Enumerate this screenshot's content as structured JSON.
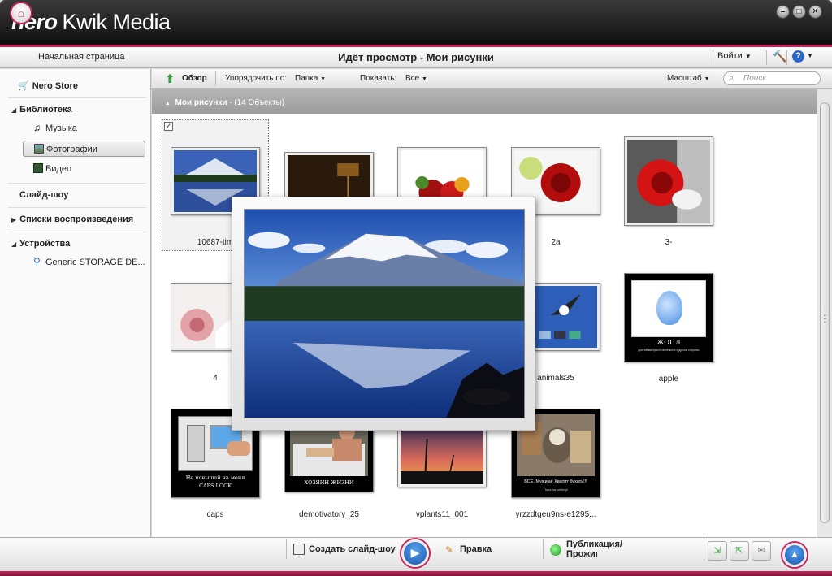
{
  "window": {
    "brand": "nero",
    "product": "Kwik Media",
    "controls": [
      "minimize",
      "maximize",
      "close"
    ]
  },
  "nav": {
    "home_label": "Начальная страница",
    "title": "Идёт просмотр - Мои рисунки",
    "login": "Войти"
  },
  "sidebar": {
    "store": "Nero Store",
    "library": "Библиотека",
    "music": "Музыка",
    "photos": "Фотографии",
    "video": "Видео",
    "slideshow": "Слайд-шоу",
    "playlists": "Списки воспроизведения",
    "devices": "Устройства",
    "device_item": "Generic STORAGE DE..."
  },
  "toolbar": {
    "browse": "Обзор",
    "sort_label": "Упорядочить по:",
    "sort_value": "Папка",
    "show_label": "Показать:",
    "show_value": "Все",
    "zoom": "Масштаб",
    "search_placeholder": "Поиск"
  },
  "group": {
    "name": "Мои рисунки",
    "count": "- (14 Объекты)"
  },
  "tiles": [
    {
      "caption": "10687-tim",
      "img": "mountain"
    },
    {
      "caption": "",
      "img": "lamp"
    },
    {
      "caption": "",
      "img": "roses"
    },
    {
      "caption": "2a",
      "img": "redrose"
    },
    {
      "caption": "3-",
      "img": "bwrose"
    },
    {
      "caption": "4",
      "img": "pinkrose"
    },
    {
      "caption": "animals35",
      "img": "eagle"
    },
    {
      "caption": "apple",
      "img": "apple"
    },
    {
      "caption": "caps",
      "img": "caps"
    },
    {
      "caption": "demotivatory_25",
      "img": "bath"
    },
    {
      "caption": "vplants11_001",
      "img": "sunset"
    },
    {
      "caption": "yrzzdtgeu9ns-e1295...",
      "img": "goat"
    }
  ],
  "poster_text": {
    "apple_title": "ЖОПЛ",
    "apple_sub": "достойная просто вательсть с другой стороны",
    "caps_line1": "Не повышай на меня",
    "caps_line2": "CAPS LOCK",
    "bath_line": "ХОЗЯИН ЖИЗНИ",
    "goat_line1": "ВСЁ, Мужики! Хватит бухать!!!",
    "goat_line2": "Пора на работу!"
  },
  "bottom": {
    "create_slideshow": "Создать слайд-шоу",
    "edit": "Правка",
    "publish_line1": "Публикация/",
    "publish_line2": "Прожиг"
  },
  "colors": {
    "accent": "#c8245c",
    "play": "#1e66c0"
  }
}
